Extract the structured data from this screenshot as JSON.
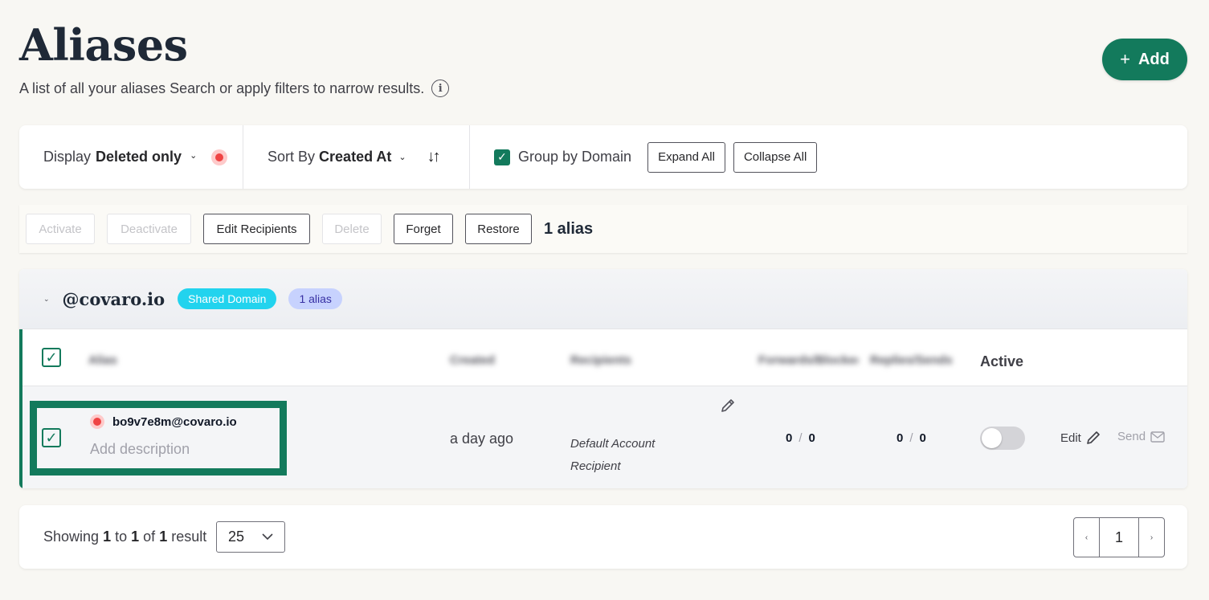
{
  "page": {
    "title": "Aliases",
    "subtitle": "A list of all your aliases Search or apply filters to narrow results.",
    "add_label": "Add",
    "accent": "#137a5c"
  },
  "filters": {
    "display_prefix": "Display",
    "display_value": "Deleted only",
    "sort_prefix": "Sort By",
    "sort_value": "Created At",
    "group_by_label": "Group by Domain",
    "group_by_checked": true,
    "expand_all": "Expand All",
    "collapse_all": "Collapse All"
  },
  "actions": {
    "activate": "Activate",
    "deactivate": "Deactivate",
    "edit_recipients": "Edit Recipients",
    "delete": "Delete",
    "forget": "Forget",
    "restore": "Restore",
    "count": "1 alias"
  },
  "group": {
    "domain": "@covaro.io",
    "badge_type": "Shared Domain",
    "badge_count": "1 alias",
    "columns": {
      "alias": "Alias",
      "created": "Created",
      "recipients": "Recipients",
      "forwards": "Forwards/Blocked",
      "replies": "Replies/Sends",
      "active": "Active"
    },
    "rows": [
      {
        "email": "bo9v7e8m@covaro.io",
        "description_placeholder": "Add description",
        "created": "a day ago",
        "recipient_line1": "Default Account",
        "recipient_line2": "Recipient",
        "forwards": "0",
        "blocked": "0",
        "replies": "0",
        "sends": "0",
        "active": false,
        "edit_label": "Edit",
        "send_label": "Send"
      }
    ]
  },
  "pagination": {
    "showing_prefix": "Showing",
    "from": "1",
    "to_word": "to",
    "to": "1",
    "of_word": "of",
    "total": "1",
    "result_word": "result",
    "per_page": "25",
    "current_page": "1"
  }
}
